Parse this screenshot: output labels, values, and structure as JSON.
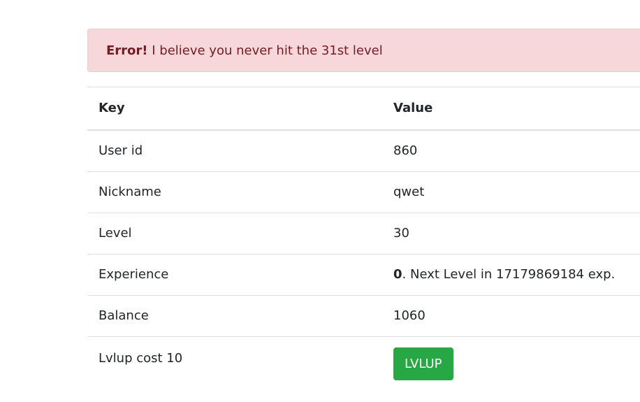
{
  "alert": {
    "strong": "Error!",
    "message": " I believe you never hit the 31st level"
  },
  "table": {
    "headers": [
      "Key",
      "Value"
    ],
    "rows": [
      {
        "key": "User id",
        "value": "860"
      },
      {
        "key": "Nickname",
        "value": "qwet"
      },
      {
        "key": "Level",
        "value": "30"
      },
      {
        "key": "Experience",
        "value_bold": "0",
        "value_rest": ". Next Level in 17179869184 exp."
      },
      {
        "key": "Balance",
        "value": "1060"
      },
      {
        "key": "Lvlup cost 10",
        "button": "LVLUP"
      }
    ]
  },
  "colors": {
    "alert_bg": "#f8d7da",
    "alert_text": "#721c24",
    "button_bg": "#28a745"
  }
}
